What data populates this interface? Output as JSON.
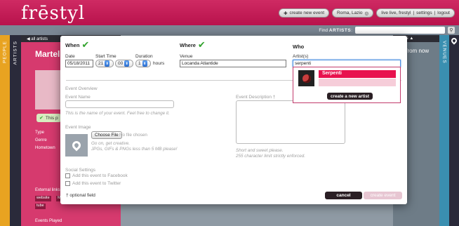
{
  "app": {
    "logo": "frēstyl"
  },
  "topbar": {
    "create_event": "create new event",
    "location": "Roma, Lazio",
    "user": "live live, frestyl",
    "settings": "settings",
    "logout": "logout"
  },
  "find": {
    "prefix": "Find",
    "scope": "ARTISTS",
    "sep": ":"
  },
  "rails": {
    "people": "PEOPLE",
    "artists": "ARTISTS",
    "venues": "VENUES"
  },
  "left_panel": {
    "back": "◀ all artists",
    "title": "Martel",
    "this_pill": "This p",
    "fields": [
      "Type",
      "Genre",
      "Hometown"
    ],
    "external_links": "External links",
    "tags": [
      "website",
      "M",
      "tube"
    ],
    "events_played": "Events Played"
  },
  "right_panel": {
    "header": "events ▲",
    "text": "s from now"
  },
  "modal": {
    "when": {
      "label": "When",
      "date_label": "Date",
      "date_value": "05/18/2011",
      "start_label": "Start Time",
      "hour": "21",
      "minute": "00",
      "duration_label": "Duration",
      "duration_value": "1",
      "duration_unit": "hours"
    },
    "where": {
      "label": "Where",
      "venue_label": "Venue",
      "venue_value": "Locanda Atlantide"
    },
    "who": {
      "label": "Who",
      "artists_label": "Artist(s)",
      "artists_value": "serpenti",
      "suggestion": "Serpenti",
      "create_artist": "create a new artist"
    },
    "overview": {
      "section": "Event Overview",
      "name_label": "Event Name",
      "name_hint": "This is the name of your event. Feel free to change it.",
      "desc_label": "Event Description †",
      "desc_hint1": "Short and sweet please.",
      "desc_hint2": "255 character limit strictly enforced.",
      "image_label": "Event Image",
      "choose_file": "Choose File",
      "no_file": "No file chosen",
      "image_hint1": "Go on, get creative.",
      "image_hint2": "JPGs, GIFs & PNGs less than 5 MB please!"
    },
    "social": {
      "section": "Social Settings",
      "facebook": "Add this event to Facebook",
      "twitter": "Add this event to Twitter"
    },
    "optional": "† optional field",
    "cancel": "cancel",
    "create_event": "create event"
  }
}
